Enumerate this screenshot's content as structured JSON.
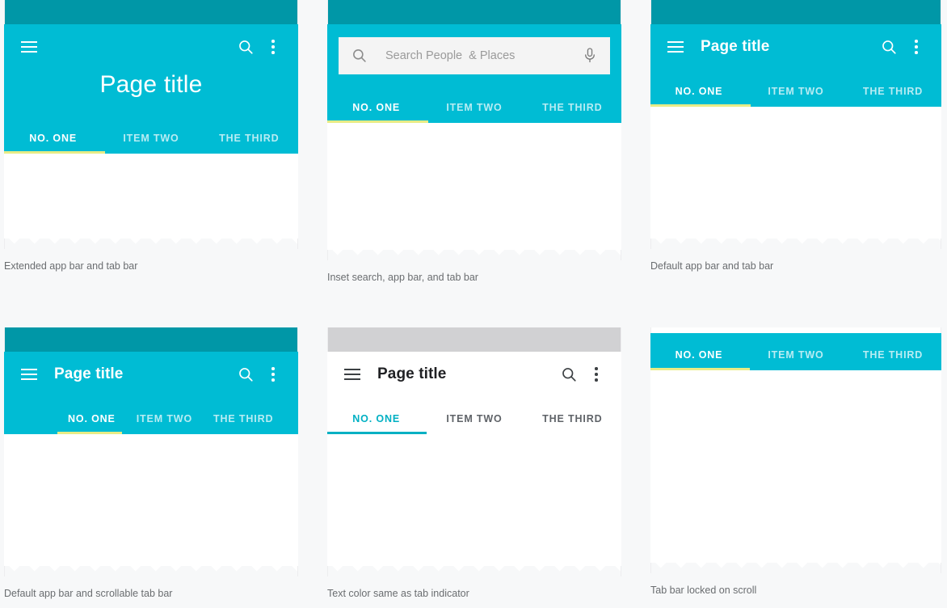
{
  "theme": {
    "status_bar_color": "#0097a7",
    "app_bar_color": "#00bcd4",
    "status_bar_gray": "#d1d1d3",
    "indicator_yellow": "#e8ec86",
    "indicator_teal": "#00b0c3",
    "page_background": "#f7f8f9",
    "card_background": "#ffffff",
    "caption_color": "#6a6d70"
  },
  "tabs": {
    "one": "NO. ONE",
    "two": "ITEM TWO",
    "three": "THE THIRD"
  },
  "cards": [
    {
      "id": "extended-app-bar",
      "title": "Page title",
      "caption": "Extended app bar and tab bar",
      "menu_icon": "hamburger-icon",
      "search_icon": "search-icon",
      "overflow_icon": "more-vert-icon"
    },
    {
      "id": "inset-search",
      "search_placeholder": "Search People  & Places",
      "caption": "Inset search, app bar, and tab bar",
      "search_icon": "search-icon",
      "mic_icon": "microphone-icon"
    },
    {
      "id": "default-app-bar",
      "title": "Page title",
      "caption": "Default app bar and tab bar",
      "menu_icon": "hamburger-icon",
      "search_icon": "search-icon",
      "overflow_icon": "more-vert-icon"
    },
    {
      "id": "scrollable-tab-bar",
      "title": "Page title",
      "caption": "Default app bar and scrollable tab bar",
      "menu_icon": "hamburger-icon",
      "search_icon": "search-icon",
      "overflow_icon": "more-vert-icon"
    },
    {
      "id": "text-color-same-as-indicator",
      "title": "Page title",
      "caption": "Text color same as tab indicator",
      "menu_icon": "hamburger-icon",
      "search_icon": "search-icon",
      "overflow_icon": "more-vert-icon"
    },
    {
      "id": "tab-bar-locked-on-scroll",
      "caption": "Tab bar locked on scroll"
    }
  ]
}
